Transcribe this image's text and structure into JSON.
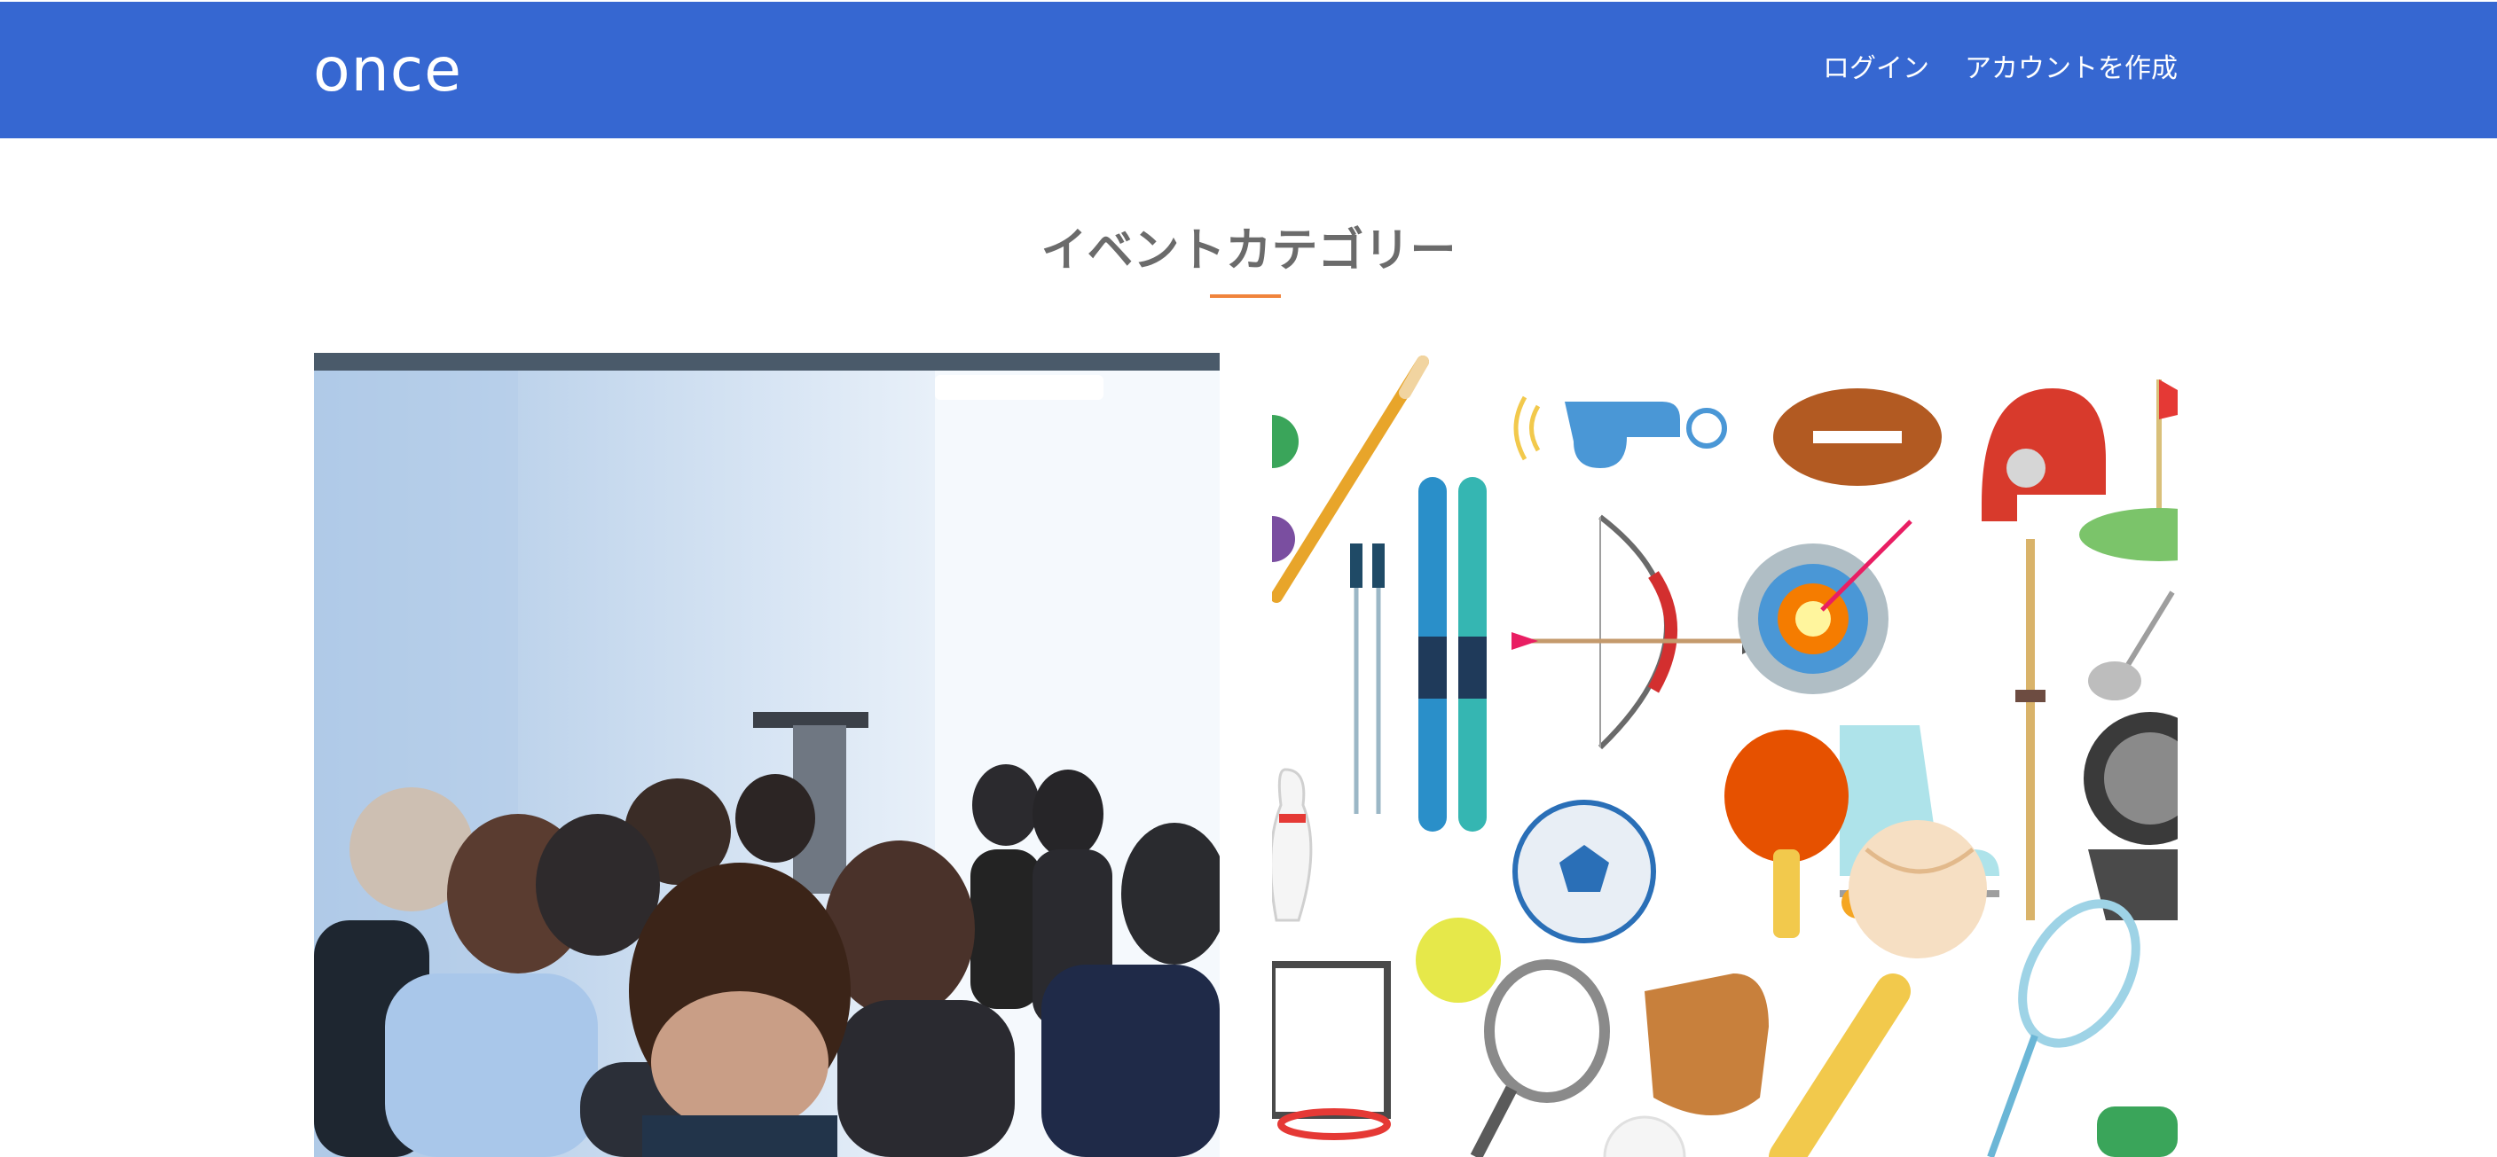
{
  "header": {
    "brand": "once",
    "links": [
      {
        "label": "ログイン"
      },
      {
        "label": "アカウントを作成"
      }
    ]
  },
  "main": {
    "section_title": "イベントカテゴリー",
    "categories": [
      {
        "image": "seminar-audience-photo"
      },
      {
        "image": "sports-equipment-illustration"
      }
    ]
  },
  "colors": {
    "navbar": "#3667d1",
    "accent_underline": "#f0843c",
    "title_text": "#6b6b6b"
  }
}
